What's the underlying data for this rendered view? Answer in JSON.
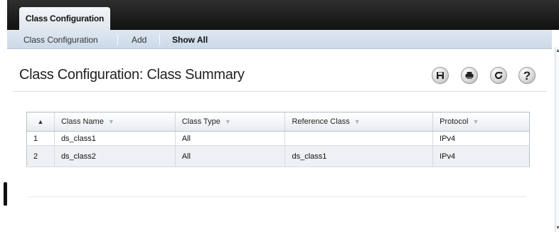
{
  "tabs": [
    {
      "label": "Class Configuration",
      "active": true
    }
  ],
  "subnav": {
    "items": [
      {
        "label": "Class Configuration",
        "active": false
      },
      {
        "label": "Add",
        "active": false
      },
      {
        "label": "Show All",
        "active": true
      }
    ]
  },
  "page": {
    "title": "Class Configuration: Class Summary"
  },
  "toolbar": {
    "icons": [
      "save-icon",
      "print-icon",
      "refresh-icon",
      "help-icon"
    ],
    "help_glyph": "?"
  },
  "table": {
    "index_header": "▲",
    "columns": [
      "Class Name",
      "Class Type",
      "Reference Class",
      "Protocol"
    ],
    "sort_caret": "▼",
    "rows": [
      {
        "index": "1",
        "class_name": "ds_class1",
        "class_type": "All",
        "reference_class": "",
        "protocol": "IPv4"
      },
      {
        "index": "2",
        "class_name": "ds_class2",
        "class_type": "All",
        "reference_class": "ds_class1",
        "protocol": "IPv4"
      }
    ]
  },
  "colors": {
    "tabbar": "#1a1a1a",
    "subnav": "#d4e0eb",
    "table_header": "#eef1f4",
    "alt_row": "#eef0f3"
  }
}
